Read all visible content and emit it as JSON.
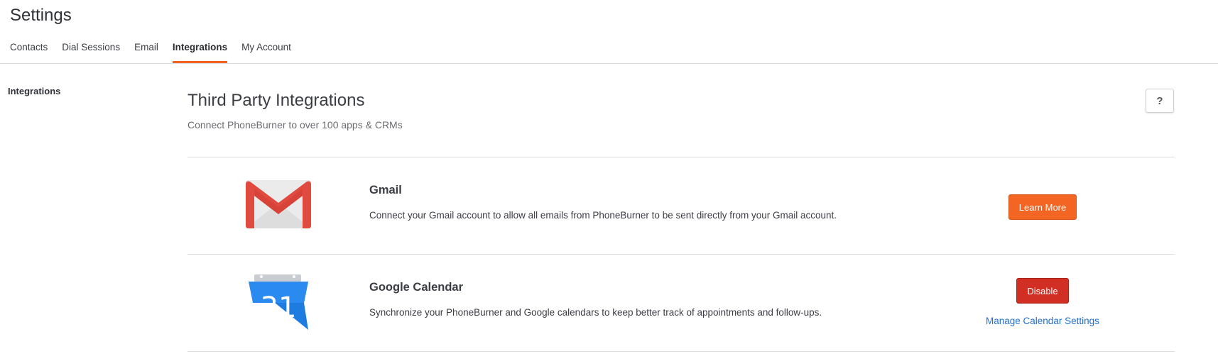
{
  "header": {
    "title": "Settings",
    "tabs": [
      {
        "label": "Contacts",
        "active": false
      },
      {
        "label": "Dial Sessions",
        "active": false
      },
      {
        "label": "Email",
        "active": false
      },
      {
        "label": "Integrations",
        "active": true
      },
      {
        "label": "My Account",
        "active": false
      }
    ]
  },
  "sidebar": {
    "items": [
      {
        "label": "Integrations"
      }
    ]
  },
  "main": {
    "title": "Third Party Integrations",
    "subtitle": "Connect PhoneBurner to over 100 apps & CRMs",
    "help_label": "?",
    "integrations": [
      {
        "name": "Gmail",
        "icon": "gmail-icon",
        "description": "Connect your Gmail account to allow all emails from PhoneBurner to be sent directly from your Gmail account.",
        "button_label": "Learn More"
      },
      {
        "name": "Google Calendar",
        "icon": "google-calendar-icon",
        "icon_text": "31",
        "description": "Synchronize your PhoneBurner and Google calendars to keep better track of appointments and follow-ups.",
        "button_label": "Disable",
        "link_label": "Manage Calendar Settings"
      }
    ]
  },
  "colors": {
    "accent": "#f26522",
    "danger": "#d12e24",
    "link": "#1f6fd0"
  }
}
